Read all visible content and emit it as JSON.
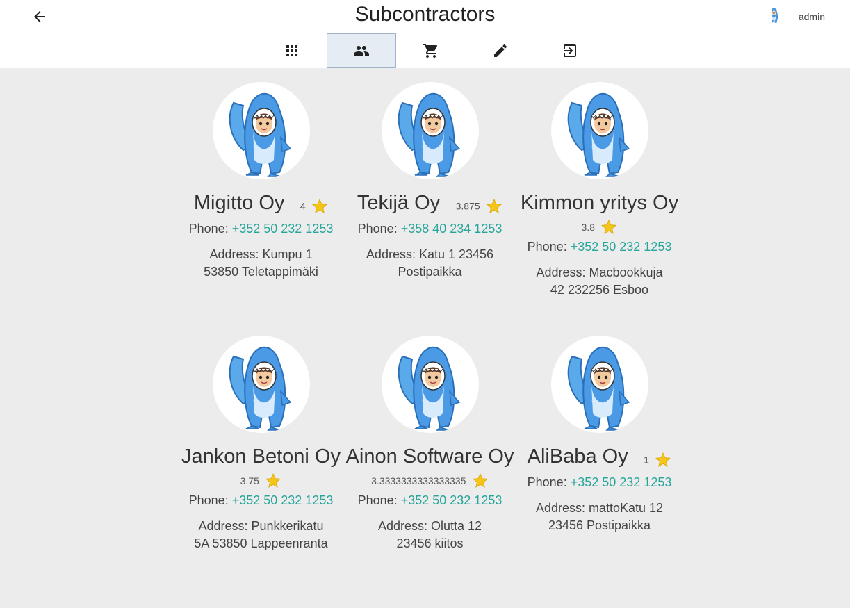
{
  "header": {
    "title": "Subcontractors",
    "user_name": "admin"
  },
  "nav": {
    "tabs": [
      {
        "icon": "grid-icon",
        "active": false
      },
      {
        "icon": "people-icon",
        "active": true
      },
      {
        "icon": "cart-icon",
        "active": false
      },
      {
        "icon": "pencil-icon",
        "active": false
      },
      {
        "icon": "logout-icon",
        "active": false
      }
    ]
  },
  "labels": {
    "phone": "Phone: ",
    "address": "Address: "
  },
  "subcontractors": [
    {
      "name": "Migitto Oy",
      "rating": "4",
      "phone": "+352 50 232 1253",
      "address": "Kumpu 1 53850 Teletappimäki"
    },
    {
      "name": "Tekijä Oy",
      "rating": "3.875",
      "phone": "+358 40 234 1253",
      "address": "Katu 1 23456 Postipaikka"
    },
    {
      "name": "Kimmon yritys Oy",
      "rating": "3.8",
      "phone": "+352 50 232 1253",
      "address": "Macbookkuja 42 232256 Esboo"
    },
    {
      "name": "Jankon Betoni Oy",
      "rating": "3.75",
      "phone": "+352 50 232 1253",
      "address": "Punkkerikatu 5A 53850 Lappeenranta"
    },
    {
      "name": "Ainon Software Oy",
      "rating": "3.3333333333333335",
      "phone": "+352 50 232 1253",
      "address": "Olutta 12 23456 kiitos"
    },
    {
      "name": "AliBaba Oy",
      "rating": "1",
      "phone": "+352 50 232 1253",
      "address": "mattoKatu 12 23456 Postipaikka"
    }
  ],
  "colors": {
    "accent": "#26a69a",
    "star": "#f5c518",
    "shark": "#3a8fd9",
    "background": "#ececec"
  }
}
